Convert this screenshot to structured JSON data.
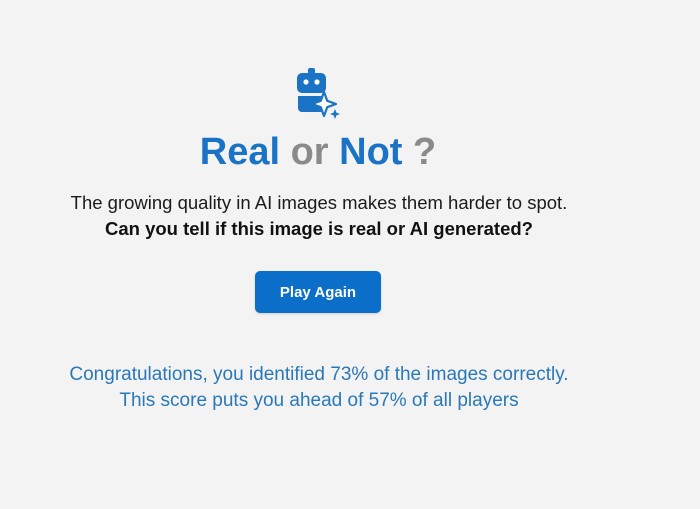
{
  "header": {
    "icon": "robot-sparkle-icon",
    "title_word1": "Real",
    "title_word2": "or",
    "title_word3": "Not",
    "title_word4": "?"
  },
  "intro": {
    "line1": "The growing quality in AI images makes them harder to spot.",
    "line2": "Can you tell if this image is real or AI generated?"
  },
  "actions": {
    "play_again_label": "Play Again"
  },
  "result": {
    "line1": "Congratulations, you identified 73% of the images correctly.",
    "line2": "This score puts you ahead of 57% of all players"
  },
  "colors": {
    "accent": "#0b6fc9",
    "title_blue": "#1a73c4",
    "title_gray": "#8a8a8a",
    "result_text": "#2a78b8",
    "background": "#f3f3f3"
  }
}
